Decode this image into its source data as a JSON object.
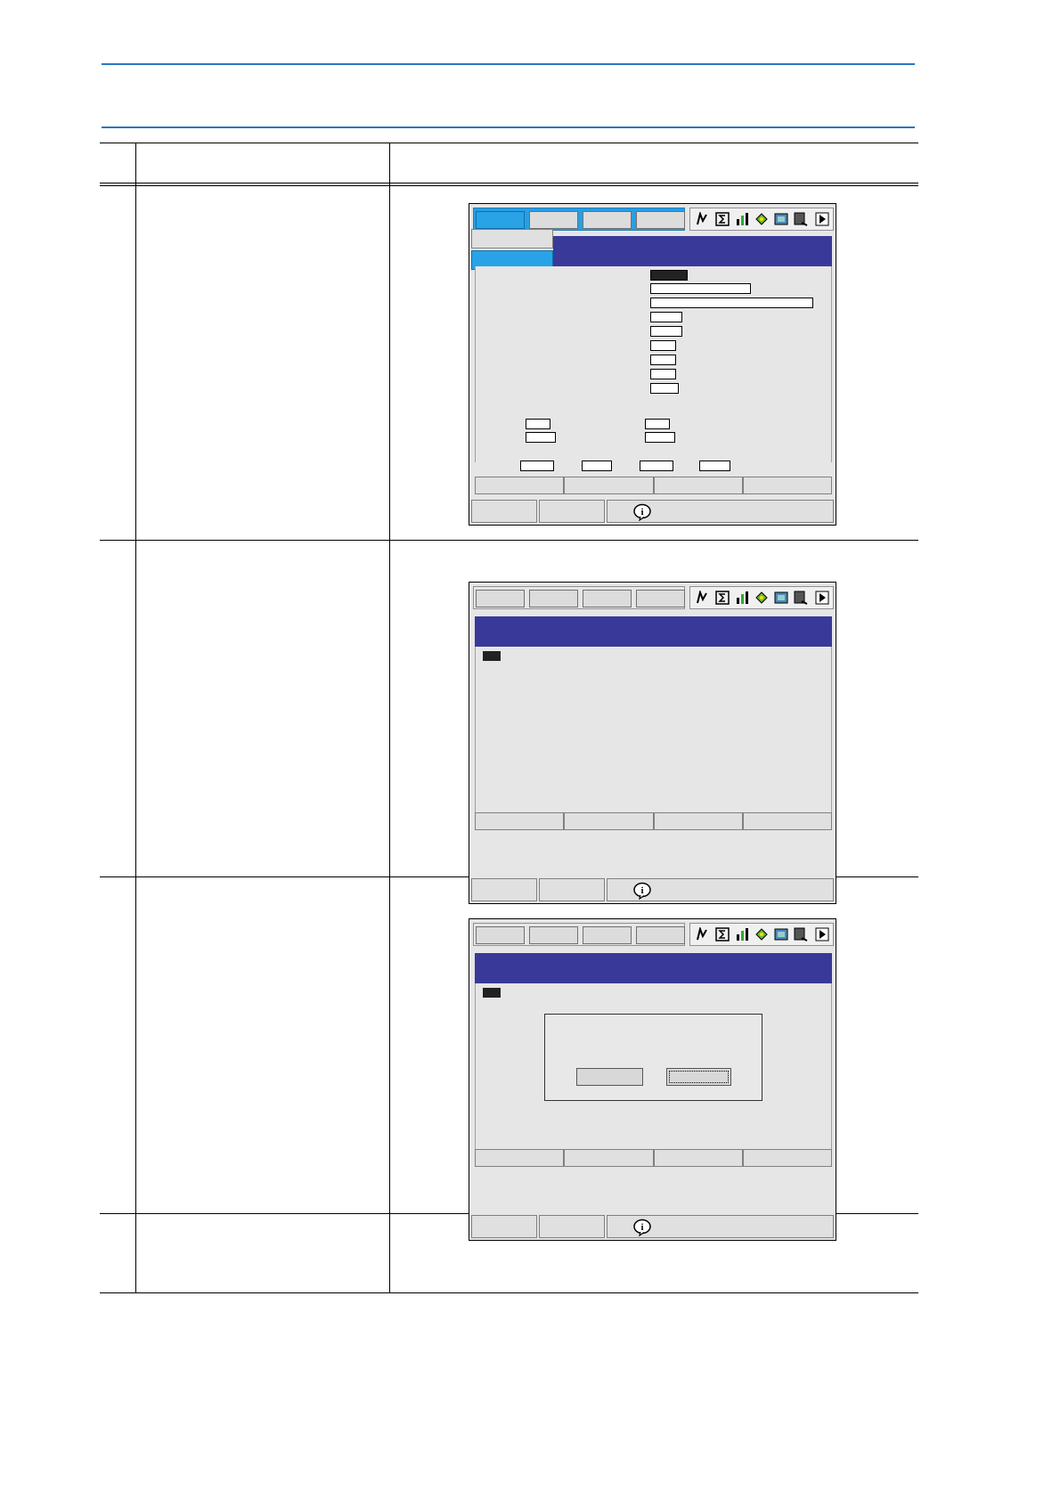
{
  "document": {
    "header_rule_color": "#2a77bd",
    "table_rows": 4
  },
  "pendant": {
    "title_bar_color": "#39399a",
    "selected_color": "#29a3e6",
    "icons": [
      "robot-axis-icon",
      "sigma-icon",
      "chart-icon",
      "tool-icon",
      "screen-icon",
      "edit-icon",
      "next-arrow-icon"
    ]
  }
}
